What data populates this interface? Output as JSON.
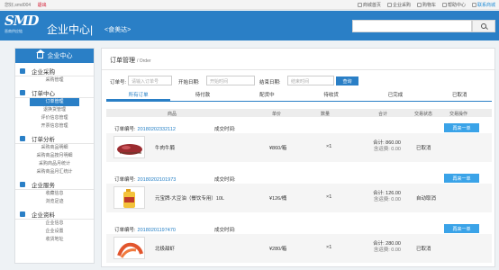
{
  "topbar": {
    "greeting": "您好,smd004",
    "logout": "退出",
    "links": [
      "商城首页",
      "企业采购",
      "购物车",
      "帮助中心",
      "联系商城"
    ]
  },
  "header": {
    "logo_text": "SMD",
    "logo_sub": "晋商供应链",
    "title": "企业中心|",
    "shop": "<食美达>",
    "search_placeholder": ""
  },
  "sidebar": {
    "home_label": "企业中心",
    "groups": [
      {
        "label": "企业采购",
        "items": [
          "采购管理"
        ]
      },
      {
        "label": "订单中心",
        "items": [
          "订单管理",
          "退换货管理",
          "评价信息管理",
          "开票信息管理"
        ]
      },
      {
        "label": "订单分析",
        "items": [
          "采购商品明细",
          "采购商品按月明细",
          "采购商品月统计",
          "采购商品月汇统计"
        ]
      },
      {
        "label": "企业服务",
        "items": [
          "收藏信息",
          "浏览足迹"
        ]
      },
      {
        "label": "企业资料",
        "items": [
          "企业信息",
          "企业设置",
          "收货地址"
        ]
      }
    ],
    "active_item": "订单管理"
  },
  "main": {
    "title": "订单管理",
    "title_en": "/ Order",
    "filters": {
      "order_no_label": "订单号:",
      "order_no_placeholder": "请输入订单号",
      "start_label": "开始日期:",
      "start_placeholder": "开始时间",
      "end_label": "结束日期:",
      "end_placeholder": "结束时间",
      "query_button": "查询"
    },
    "tabs": [
      "所有订单",
      "待付款",
      "配货中",
      "待收货",
      "已完成",
      "已取消"
    ],
    "active_tab": "所有订单",
    "columns": [
      "商品",
      "单价",
      "数量",
      "合计",
      "交易状态",
      "交易操作"
    ],
    "orders": [
      {
        "no_label": "订单编号:",
        "no": "20180202332112",
        "time_label": "成交时间:",
        "product": "牛肉牛腩",
        "price": "¥860/箱",
        "qty": "×1",
        "total": "合计: 860.00",
        "shipping": "含运费: 0.00",
        "status": "已取消",
        "action": "再来一单"
      },
      {
        "no_label": "订单编号:",
        "no": "20180202101973",
        "time_label": "成交时间:",
        "product": "元宝牌-大豆油（餐饮专用）10L",
        "price": "¥126/桶",
        "qty": "×1",
        "total": "合计: 126.00",
        "shipping": "含运费: 0.00",
        "status": "自动取消",
        "action": "再来一单"
      },
      {
        "no_label": "订单编号:",
        "no": "20180201197470",
        "time_label": "成交时间:",
        "product": "北极甜虾",
        "price": "¥280/箱",
        "qty": "×1",
        "total": "合计: 280.00",
        "shipping": "含运费: 0.00",
        "status": "已取消",
        "action": "再来一单"
      }
    ]
  },
  "colors": {
    "brand": "#2a7fc6",
    "accent_button": "#3aa3e8",
    "link": "#1f7cc4",
    "logout": "#d0021b"
  }
}
